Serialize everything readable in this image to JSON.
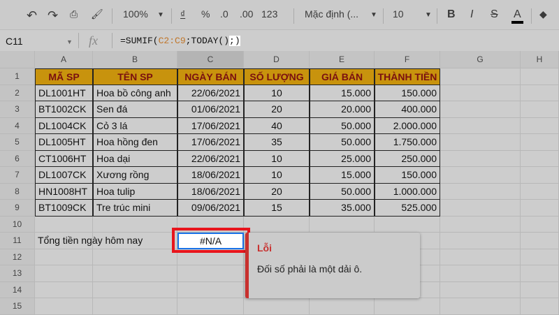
{
  "toolbar": {
    "zoom": "100%",
    "currency": "₫",
    "percent": "%",
    "dec_less": ".0",
    "dec_more": ".00",
    "format_more": "123",
    "font": "Mặc định (...",
    "font_size": "10",
    "bold": "B",
    "italic": "I",
    "strike": "S",
    "text_color": "A"
  },
  "formula_bar": {
    "cell_ref": "C11",
    "fx": "fx",
    "f_prefix": "=SUMIF(",
    "f_ref": "C2:C9",
    "f_mid": ";TODAY()",
    "f_hl": ";)"
  },
  "columns": [
    "A",
    "B",
    "C",
    "D",
    "E",
    "F",
    "G",
    "H"
  ],
  "rows": [
    "1",
    "2",
    "3",
    "4",
    "5",
    "6",
    "7",
    "8",
    "9",
    "10",
    "11",
    "12",
    "13",
    "14",
    "15"
  ],
  "table": {
    "headers": [
      "MÃ SP",
      "TÊN SP",
      "NGÀY BÁN",
      "SỐ LƯỢNG",
      "GIÁ BÁN",
      "THÀNH TIỀN"
    ],
    "data": [
      [
        "DL1001HT",
        "Hoa bồ công anh",
        "22/06/2021",
        "10",
        "15.000",
        "150.000"
      ],
      [
        "BT1002CK",
        "Sen đá",
        "01/06/2021",
        "20",
        "20.000",
        "400.000"
      ],
      [
        "DL1004CK",
        "Cỏ 3 lá",
        "17/06/2021",
        "40",
        "50.000",
        "2.000.000"
      ],
      [
        "DL1005HT",
        "Hoa hồng đen",
        "17/06/2021",
        "35",
        "50.000",
        "1.750.000"
      ],
      [
        "CT1006HT",
        "Hoa dại",
        "22/06/2021",
        "10",
        "25.000",
        "250.000"
      ],
      [
        "DL1007CK",
        "Xương rồng",
        "18/06/2021",
        "10",
        "15.000",
        "150.000"
      ],
      [
        "HN1008HT",
        "Hoa tulip",
        "18/06/2021",
        "20",
        "50.000",
        "1.000.000"
      ],
      [
        "BT1009CK",
        "Tre trúc mini",
        "09/06/2021",
        "15",
        "35.000",
        "525.000"
      ]
    ]
  },
  "row11": {
    "label": "Tổng tiền ngày hôm nay",
    "value": "#N/A"
  },
  "error_tooltip": {
    "title": "Lỗi",
    "message": "Đối số phải là một dải ô."
  }
}
